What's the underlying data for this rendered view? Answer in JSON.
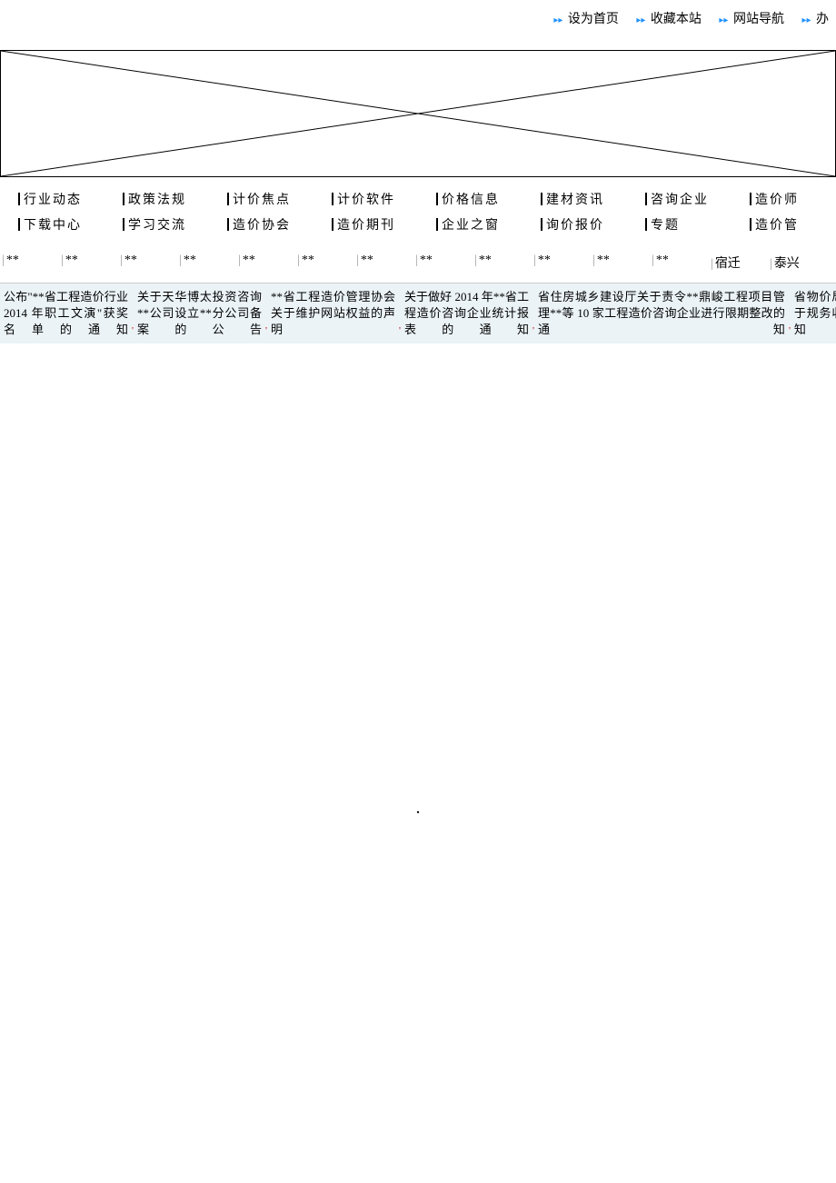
{
  "top_links": [
    {
      "label": "设为首页"
    },
    {
      "label": "收藏本站"
    },
    {
      "label": "网站导航"
    },
    {
      "label": "办"
    }
  ],
  "nav": {
    "row1": [
      {
        "label": "行业动态"
      },
      {
        "label": "政策法规"
      },
      {
        "label": "计价焦点"
      },
      {
        "label": "计价软件"
      },
      {
        "label": "价格信息"
      },
      {
        "label": "建材资讯"
      },
      {
        "label": "咨询企业"
      },
      {
        "label": "造价师"
      }
    ],
    "row2": [
      {
        "label": "下载中心"
      },
      {
        "label": "学习交流"
      },
      {
        "label": "造价协会"
      },
      {
        "label": "造价期刊"
      },
      {
        "label": "企业之窗"
      },
      {
        "label": "询价报价"
      },
      {
        "label": "专题"
      },
      {
        "label": "造价管"
      }
    ]
  },
  "regions": [
    {
      "label": "**"
    },
    {
      "label": "**"
    },
    {
      "label": "**"
    },
    {
      "label": "**"
    },
    {
      "label": "**"
    },
    {
      "label": "**"
    },
    {
      "label": "**"
    },
    {
      "label": "**"
    },
    {
      "label": "**"
    },
    {
      "label": "**"
    },
    {
      "label": "**"
    },
    {
      "label": "**"
    },
    {
      "label": "宿迁"
    },
    {
      "label": "泰兴"
    }
  ],
  "notices": [
    {
      "text": "公布\"**省工程造价行业 2014 年职工文演\"获奖名单的通知"
    },
    {
      "text": "关于天华博太投资咨询**公司设立**分公司备案的公告"
    },
    {
      "text": "**省工程造价管理协会关于维护网站权益的声明"
    },
    {
      "text": "关于做好 2014 年**省工程造价咨询企业统计报表的通知"
    },
    {
      "text": "省住房城乡建设厅关于责令**鼎峻工程项目管理**等 10 家工程造价咨询企业进行限期整改的通知"
    },
    {
      "text": "省物价局厅关于规务收费标知"
    }
  ]
}
